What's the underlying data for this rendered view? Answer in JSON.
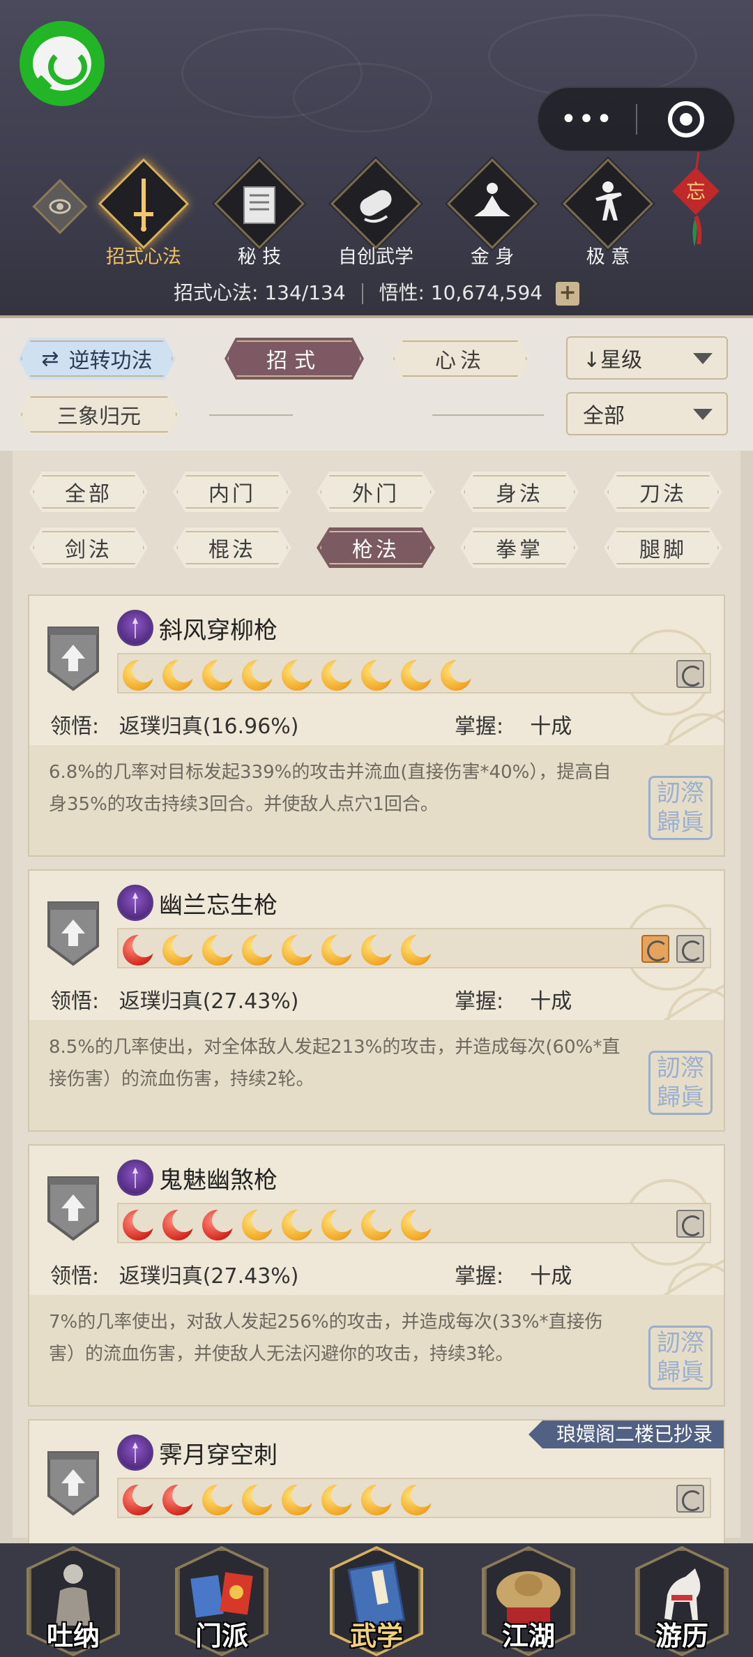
{
  "header": {
    "tabs": [
      {
        "label": "招式心法",
        "icon": "sword-icon",
        "active": true
      },
      {
        "label": "秘 技",
        "icon": "book-icon",
        "active": false
      },
      {
        "label": "自创武学",
        "icon": "scroll-icon",
        "active": false
      },
      {
        "label": "金 身",
        "icon": "meditation-icon",
        "active": false
      },
      {
        "label": "极 意",
        "icon": "martial-pose-icon",
        "active": false
      }
    ],
    "knot_char": "忘",
    "stats": {
      "skills_label": "招式心法:",
      "skills_value": "134/134",
      "insight_label": "悟性:",
      "insight_value": "10,674,594"
    }
  },
  "controls": {
    "reverse_button": "逆转功法",
    "moves_tab": "招式",
    "mind_tab": "心法",
    "sort_select": "↓星级",
    "sanxiang_button": "三象归元",
    "filter_select": "全部"
  },
  "filters": [
    "全部",
    "内门",
    "外门",
    "身法",
    "刀法",
    "剑法",
    "棍法",
    "枪法",
    "拳掌",
    "腿脚"
  ],
  "selected_filter": "枪法",
  "skills": [
    {
      "name": "斜风穿柳枪",
      "moons": [
        "gold",
        "gold",
        "gold",
        "gold",
        "gold",
        "gold",
        "gold",
        "gold",
        "gold"
      ],
      "badges": [
        "gray"
      ],
      "comprehension_label": "领悟:",
      "comprehension_value": "返璞归真(16.96%)",
      "mastery_label": "掌握:",
      "mastery_value": "十成",
      "description": "6.8%的几率对目标发起339%的攻击并流血(直接伤害*40%），提高自身35%的攻击持续3回合。并使敌人点穴1回合。",
      "seal_text": "訒漈歸眞"
    },
    {
      "name": "幽兰忘生枪",
      "moons": [
        "red",
        "gold",
        "gold",
        "gold",
        "gold",
        "gold",
        "gold",
        "gold"
      ],
      "badges": [
        "orange",
        "gray"
      ],
      "comprehension_label": "领悟:",
      "comprehension_value": "返璞归真(27.43%)",
      "mastery_label": "掌握:",
      "mastery_value": "十成",
      "description": "8.5%的几率使出，对全体敌人发起213%的攻击，并造成每次(60%*直接伤害）的流血伤害，持续2轮。",
      "seal_text": "訒漈歸眞"
    },
    {
      "name": "鬼魅幽煞枪",
      "moons": [
        "red",
        "red",
        "red",
        "gold",
        "gold",
        "gold",
        "gold",
        "gold"
      ],
      "badges": [
        "gray"
      ],
      "comprehension_label": "领悟:",
      "comprehension_value": "返璞归真(27.43%)",
      "mastery_label": "掌握:",
      "mastery_value": "十成",
      "description": "7%的几率使出，对敌人发起256%的攻击，并造成每次(33%*直接伤害）的流血伤害，并使敌人无法闪避你的攻击，持续3轮。",
      "seal_text": "訒漈歸眞"
    },
    {
      "name": "霁月穿空刺",
      "moons": [
        "red",
        "red",
        "gold",
        "gold",
        "gold",
        "gold",
        "gold",
        "gold"
      ],
      "badges": [
        "gray"
      ],
      "copied_tag": "琅嬛阁二楼已抄录"
    }
  ],
  "bottom_nav": [
    {
      "label": "吐纳",
      "icon": "figure-icon",
      "active": false
    },
    {
      "label": "门派",
      "icon": "sect-banner-icon",
      "active": false
    },
    {
      "label": "武学",
      "icon": "manual-book-icon",
      "active": true
    },
    {
      "label": "江湖",
      "icon": "straw-hat-icon",
      "active": false
    },
    {
      "label": "游历",
      "icon": "horse-icon",
      "active": false
    }
  ],
  "colors": {
    "active_gold": "#f2c25b",
    "selected_pill": "#7b5a62",
    "moon_gold": "#f1a623",
    "moon_red": "#d4281e"
  }
}
